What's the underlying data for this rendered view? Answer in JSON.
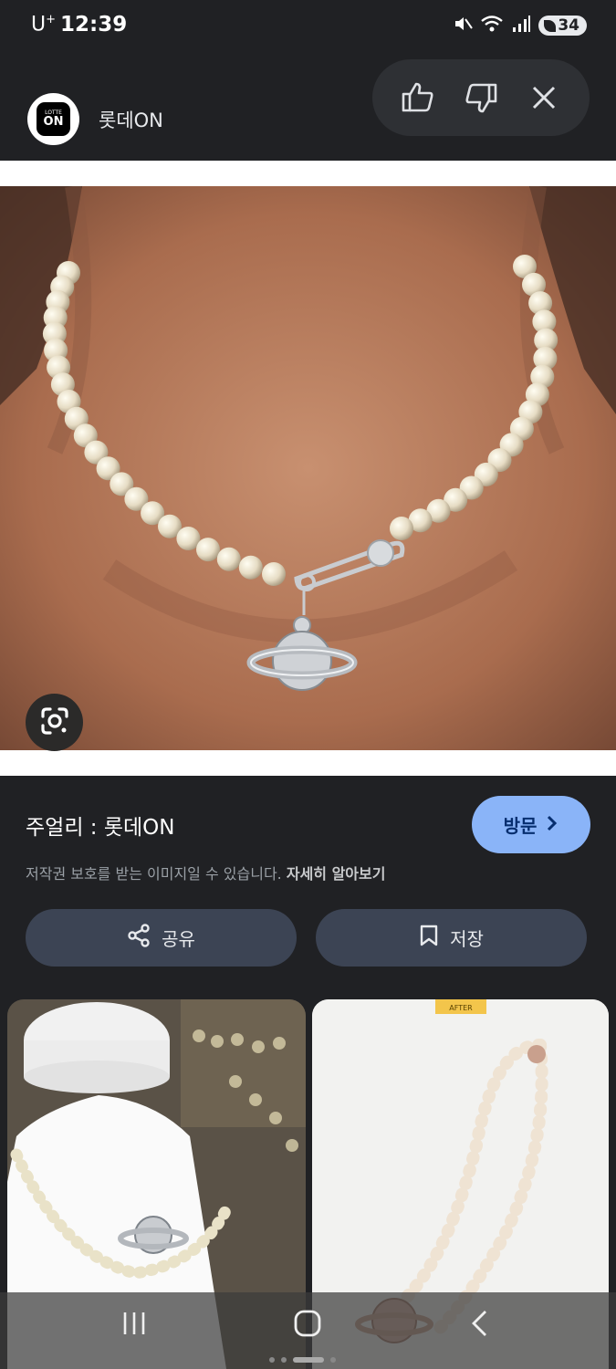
{
  "status_bar": {
    "carrier": "U",
    "carrier_sup": "+",
    "time": "12:39",
    "battery": "34"
  },
  "header": {
    "logo_top": "LOTTE",
    "logo_main": "ON",
    "site_name": "롯데ON"
  },
  "result": {
    "title": "주얼리 : 롯데ON",
    "visit_label": "방문",
    "copyright_text": "저작권 보호를 받는 이미지일 수 있습니다. ",
    "learn_more": "자세히 알아보기"
  },
  "actions": {
    "share_label": "공유",
    "save_label": "저장"
  },
  "related": {
    "right_badge": "AFTER"
  },
  "icons": {
    "like": "thumbs-up-icon",
    "dislike": "thumbs-down-icon",
    "close": "close-icon",
    "lens": "google-lens-icon",
    "share": "share-icon",
    "save": "bookmark-icon"
  },
  "colors": {
    "background": "#202124",
    "visit_button": "#8ab4f8",
    "action_button": "#3c4454"
  }
}
